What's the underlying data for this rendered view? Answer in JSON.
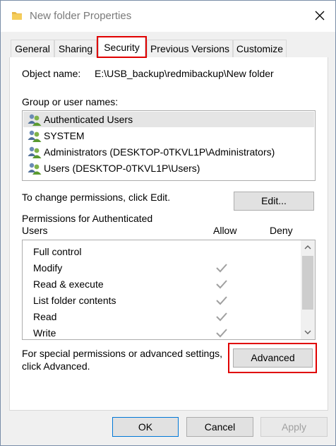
{
  "window": {
    "title": "New folder Properties",
    "tabs": [
      {
        "label": "General"
      },
      {
        "label": "Sharing"
      },
      {
        "label": "Security"
      },
      {
        "label": "Previous Versions"
      },
      {
        "label": "Customize"
      }
    ],
    "active_tab": "Security"
  },
  "security": {
    "object_name_label": "Object name:",
    "object_name_value": "E:\\USB_backup\\redmibackup\\New folder",
    "group_label": "Group or user names:",
    "users": [
      {
        "name": "Authenticated Users",
        "selected": true
      },
      {
        "name": "SYSTEM",
        "selected": false
      },
      {
        "name": "Administrators (DESKTOP-0TKVL1P\\Administrators)",
        "selected": false
      },
      {
        "name": "Users (DESKTOP-0TKVL1P\\Users)",
        "selected": false
      }
    ],
    "change_text": "To change permissions, click Edit.",
    "edit_button": "Edit...",
    "permissions_label_line1": "Permissions for Authenticated",
    "permissions_label_line2": "Users",
    "allow_header": "Allow",
    "deny_header": "Deny",
    "permissions": [
      {
        "name": "Full control",
        "allow": false,
        "deny": false
      },
      {
        "name": "Modify",
        "allow": true,
        "deny": false
      },
      {
        "name": "Read & execute",
        "allow": true,
        "deny": false
      },
      {
        "name": "List folder contents",
        "allow": true,
        "deny": false
      },
      {
        "name": "Read",
        "allow": true,
        "deny": false
      },
      {
        "name": "Write",
        "allow": true,
        "deny": false
      }
    ],
    "special_text_line1": "For special permissions or advanced settings,",
    "special_text_line2": "click Advanced.",
    "advanced_button": "Advanced"
  },
  "footer": {
    "ok_label": "OK",
    "cancel_label": "Cancel",
    "apply_label": "Apply"
  },
  "colors": {
    "highlight_red": "#e00000",
    "selected_row": "#e5e5e5",
    "check_gray": "#a0a0a0"
  }
}
